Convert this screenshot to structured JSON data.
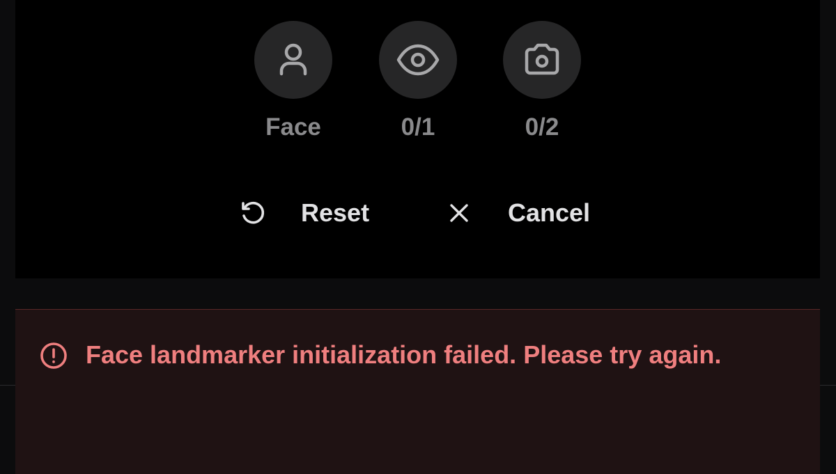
{
  "steps": [
    {
      "icon": "person-icon",
      "label": "Face"
    },
    {
      "icon": "eye-icon",
      "label": "0/1"
    },
    {
      "icon": "camera-icon",
      "label": "0/2"
    }
  ],
  "actions": {
    "reset_label": "Reset",
    "cancel_label": "Cancel"
  },
  "error": {
    "icon": "alert-circle-icon",
    "message": "Face landmarker initialization failed. Please try again."
  },
  "colors": {
    "background": "#0c0c0d",
    "panel": "#000000",
    "step_circle": "#262627",
    "icon_muted": "#a8a8aa",
    "label_muted": "#8a8a8c",
    "action_text": "#e2e2e4",
    "error_bg": "#1f1213",
    "error_text": "#ef7f7f"
  }
}
